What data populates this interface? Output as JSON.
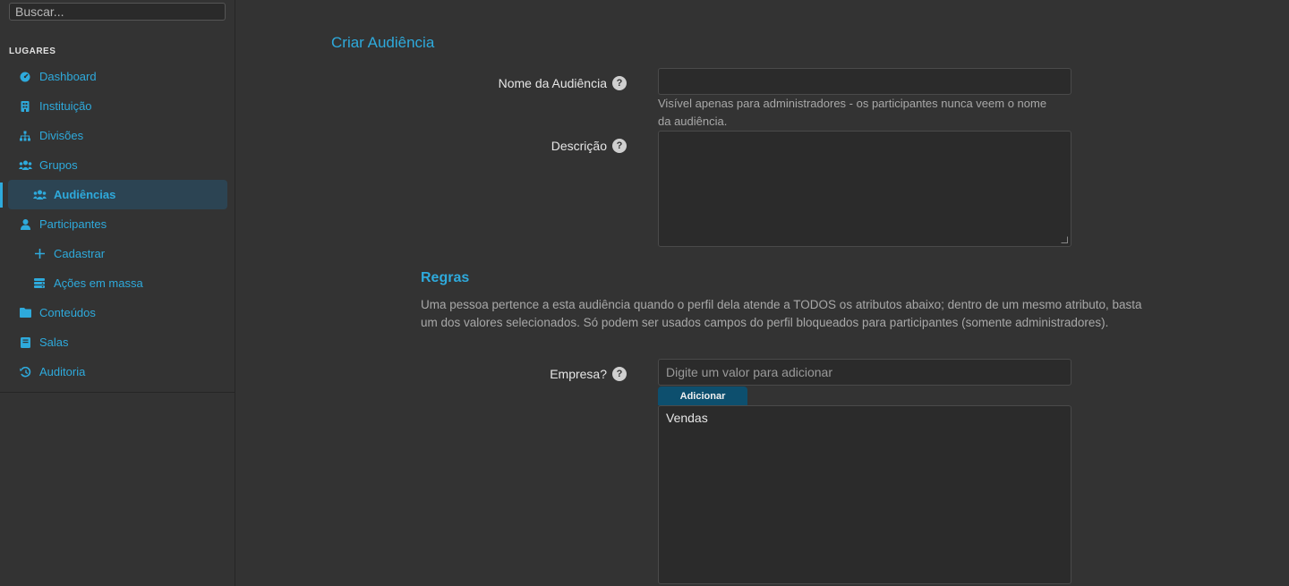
{
  "search": {
    "placeholder": "Buscar..."
  },
  "sidebar": {
    "section_title": "LUGARES",
    "items": [
      {
        "label": "Dashboard",
        "icon": "dashboard-icon"
      },
      {
        "label": "Instituição",
        "icon": "building-icon"
      },
      {
        "label": "Divisões",
        "icon": "sitemap-icon"
      },
      {
        "label": "Grupos",
        "icon": "users-icon"
      },
      {
        "label": "Audiências",
        "icon": "users-icon",
        "active": true,
        "sub": true
      },
      {
        "label": "Participantes",
        "icon": "user-icon"
      },
      {
        "label": "Cadastrar",
        "icon": "plus-icon",
        "sub": true
      },
      {
        "label": "Ações em massa",
        "icon": "database-icon",
        "sub": true
      },
      {
        "label": "Conteúdos",
        "icon": "folder-icon"
      },
      {
        "label": "Salas",
        "icon": "book-icon"
      },
      {
        "label": "Auditoria",
        "icon": "history-icon"
      }
    ]
  },
  "form": {
    "title": "Criar Audiência",
    "name_label": "Nome da Audiência",
    "name_value": "",
    "name_hint": "Visível apenas para administradores - os participantes nunca veem o nome da audiência.",
    "description_label": "Descrição",
    "description_value": "",
    "rules_title": "Regras",
    "rules_description": "Uma pessoa pertence a esta audiência quando o perfil dela atende a TODOS os atributos abaixo; dentro de um mesmo atributo, basta um dos valores selecionados. Só podem ser usados campos do perfil bloqueados para participantes (somente administradores).",
    "company_label": "Empresa?",
    "company_placeholder": "Digite um valor para adicionar",
    "add_button": "Adicionar",
    "values": [
      "Vendas"
    ]
  },
  "colors": {
    "accent": "#2eaadc",
    "background": "#333333",
    "active_bg": "#2c4453",
    "button_bg": "#0d4f6e"
  }
}
